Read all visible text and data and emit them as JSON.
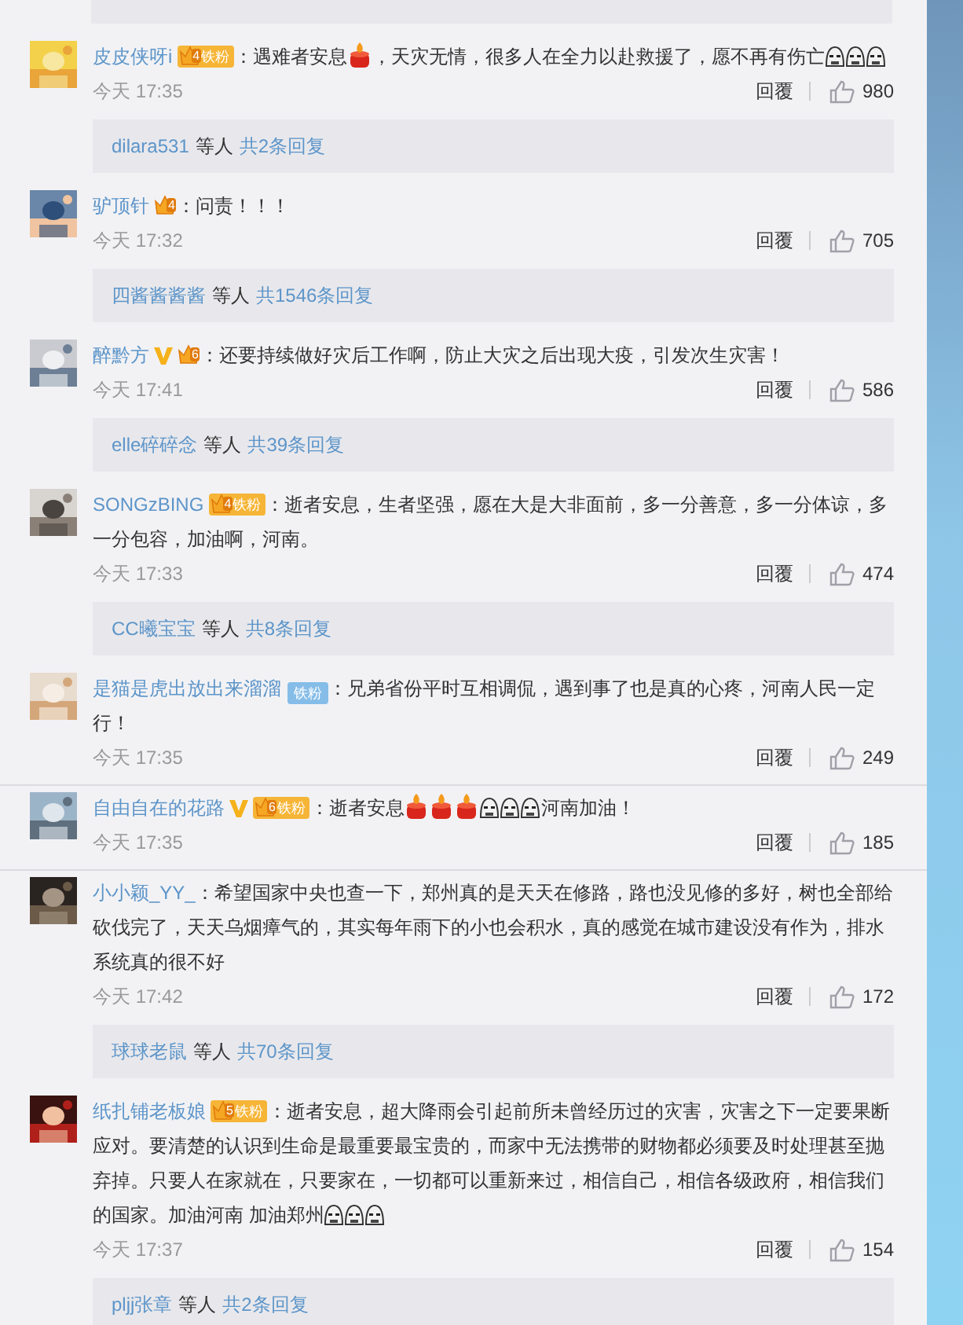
{
  "comments": [
    {
      "user": "皮皮侠呀i",
      "badges": [
        {
          "kind": "crown",
          "number": "4",
          "label": "铁粉"
        }
      ],
      "parts": [
        {
          "kind": "text",
          "text": "：遇难者安息"
        },
        {
          "kind": "candle"
        },
        {
          "kind": "text",
          "text": "，天灾无情，很多人在全力以赴救援了，愿不再有伤亡"
        },
        {
          "kind": "cry"
        },
        {
          "kind": "cry"
        },
        {
          "kind": "cry"
        }
      ],
      "time": "今天 17:35",
      "reply": "回覆",
      "likes": "980",
      "replies": {
        "users": "dilara531",
        "suffix": "等人",
        "total": "共2条回复"
      }
    },
    {
      "user": "驴顶针",
      "badges": [
        {
          "kind": "crown",
          "number": "4"
        }
      ],
      "parts": [
        {
          "kind": "text",
          "text": "：问责！！！"
        }
      ],
      "time": "今天 17:32",
      "reply": "回覆",
      "likes": "705",
      "replies": {
        "users": "四酱酱酱酱",
        "suffix": "等人",
        "total": "共1546条回复"
      }
    },
    {
      "user": "醉黔方",
      "badges": [
        {
          "kind": "verified"
        },
        {
          "kind": "crown",
          "number": "6"
        }
      ],
      "parts": [
        {
          "kind": "text",
          "text": "：还要持续做好灾后工作啊，防止大灾之后出现大疫，引发次生灾害！"
        }
      ],
      "time": "今天 17:41",
      "reply": "回覆",
      "likes": "586",
      "replies": {
        "users": "elle碎碎念",
        "suffix": "等人",
        "total": "共39条回复"
      }
    },
    {
      "user": "SONGzBING",
      "badges": [
        {
          "kind": "crown",
          "number": "4",
          "label": "铁粉"
        }
      ],
      "parts": [
        {
          "kind": "text",
          "text": "：逝者安息，生者坚强，愿在大是大非面前，多一分善意，多一分体谅，多一分包容，加油啊，河南。"
        }
      ],
      "time": "今天 17:33",
      "reply": "回覆",
      "likes": "474",
      "replies": {
        "users": "CC曦宝宝",
        "suffix": "等人",
        "total": "共8条回复"
      }
    },
    {
      "user": "是猫是虎出放出来溜溜",
      "badges": [
        {
          "kind": "fan",
          "label": "铁粉"
        }
      ],
      "parts": [
        {
          "kind": "text",
          "text": "：兄弟省份平时互相调侃，遇到事了也是真的心疼，河南人民一定行！"
        }
      ],
      "time": "今天 17:35",
      "reply": "回覆",
      "likes": "249"
    },
    {
      "user": "自由自在的花路",
      "badges": [
        {
          "kind": "verified"
        },
        {
          "kind": "crown",
          "number": "6",
          "label": "铁粉"
        }
      ],
      "parts": [
        {
          "kind": "text",
          "text": "：逝者安息"
        },
        {
          "kind": "candle"
        },
        {
          "kind": "candle"
        },
        {
          "kind": "candle"
        },
        {
          "kind": "cry"
        },
        {
          "kind": "cry"
        },
        {
          "kind": "cry"
        },
        {
          "kind": "text",
          "text": "河南加油！"
        }
      ],
      "time": "今天 17:35",
      "reply": "回覆",
      "likes": "185"
    },
    {
      "user": "小小颖_YY_",
      "parts": [
        {
          "kind": "text",
          "text": "：希望国家中央也查一下，郑州真的是天天在修路，路也没见修的多好，树也全部给砍伐完了，天天乌烟瘴气的，其实每年雨下的小也会积水，真的感觉在城市建设没有作为，排水系统真的很不好"
        }
      ],
      "time": "今天 17:42",
      "reply": "回覆",
      "likes": "172",
      "replies": {
        "users": "球球老鼠",
        "suffix": "等人",
        "total": "共70条回复"
      }
    },
    {
      "user": "纸扎铺老板娘",
      "badges": [
        {
          "kind": "crown",
          "number": "5",
          "label": "铁粉"
        }
      ],
      "parts": [
        {
          "kind": "text",
          "text": "：逝者安息，超大降雨会引起前所未曾经历过的灾害，灾害之下一定要果断应对。要清楚的认识到生命是最重要最宝贵的，而家中无法携带的财物都必须要及时处理甚至抛弃掉。只要人在家就在，只要家在，一切都可以重新来过，相信自己，相信各级政府，相信我们的国家。加油河南  加油郑州"
        },
        {
          "kind": "cry"
        },
        {
          "kind": "cry"
        },
        {
          "kind": "cry"
        }
      ],
      "time": "今天 17:37",
      "reply": "回覆",
      "likes": "154",
      "replies": {
        "users": "pljj张章",
        "suffix": "等人",
        "total": "共2条回复"
      }
    }
  ]
}
